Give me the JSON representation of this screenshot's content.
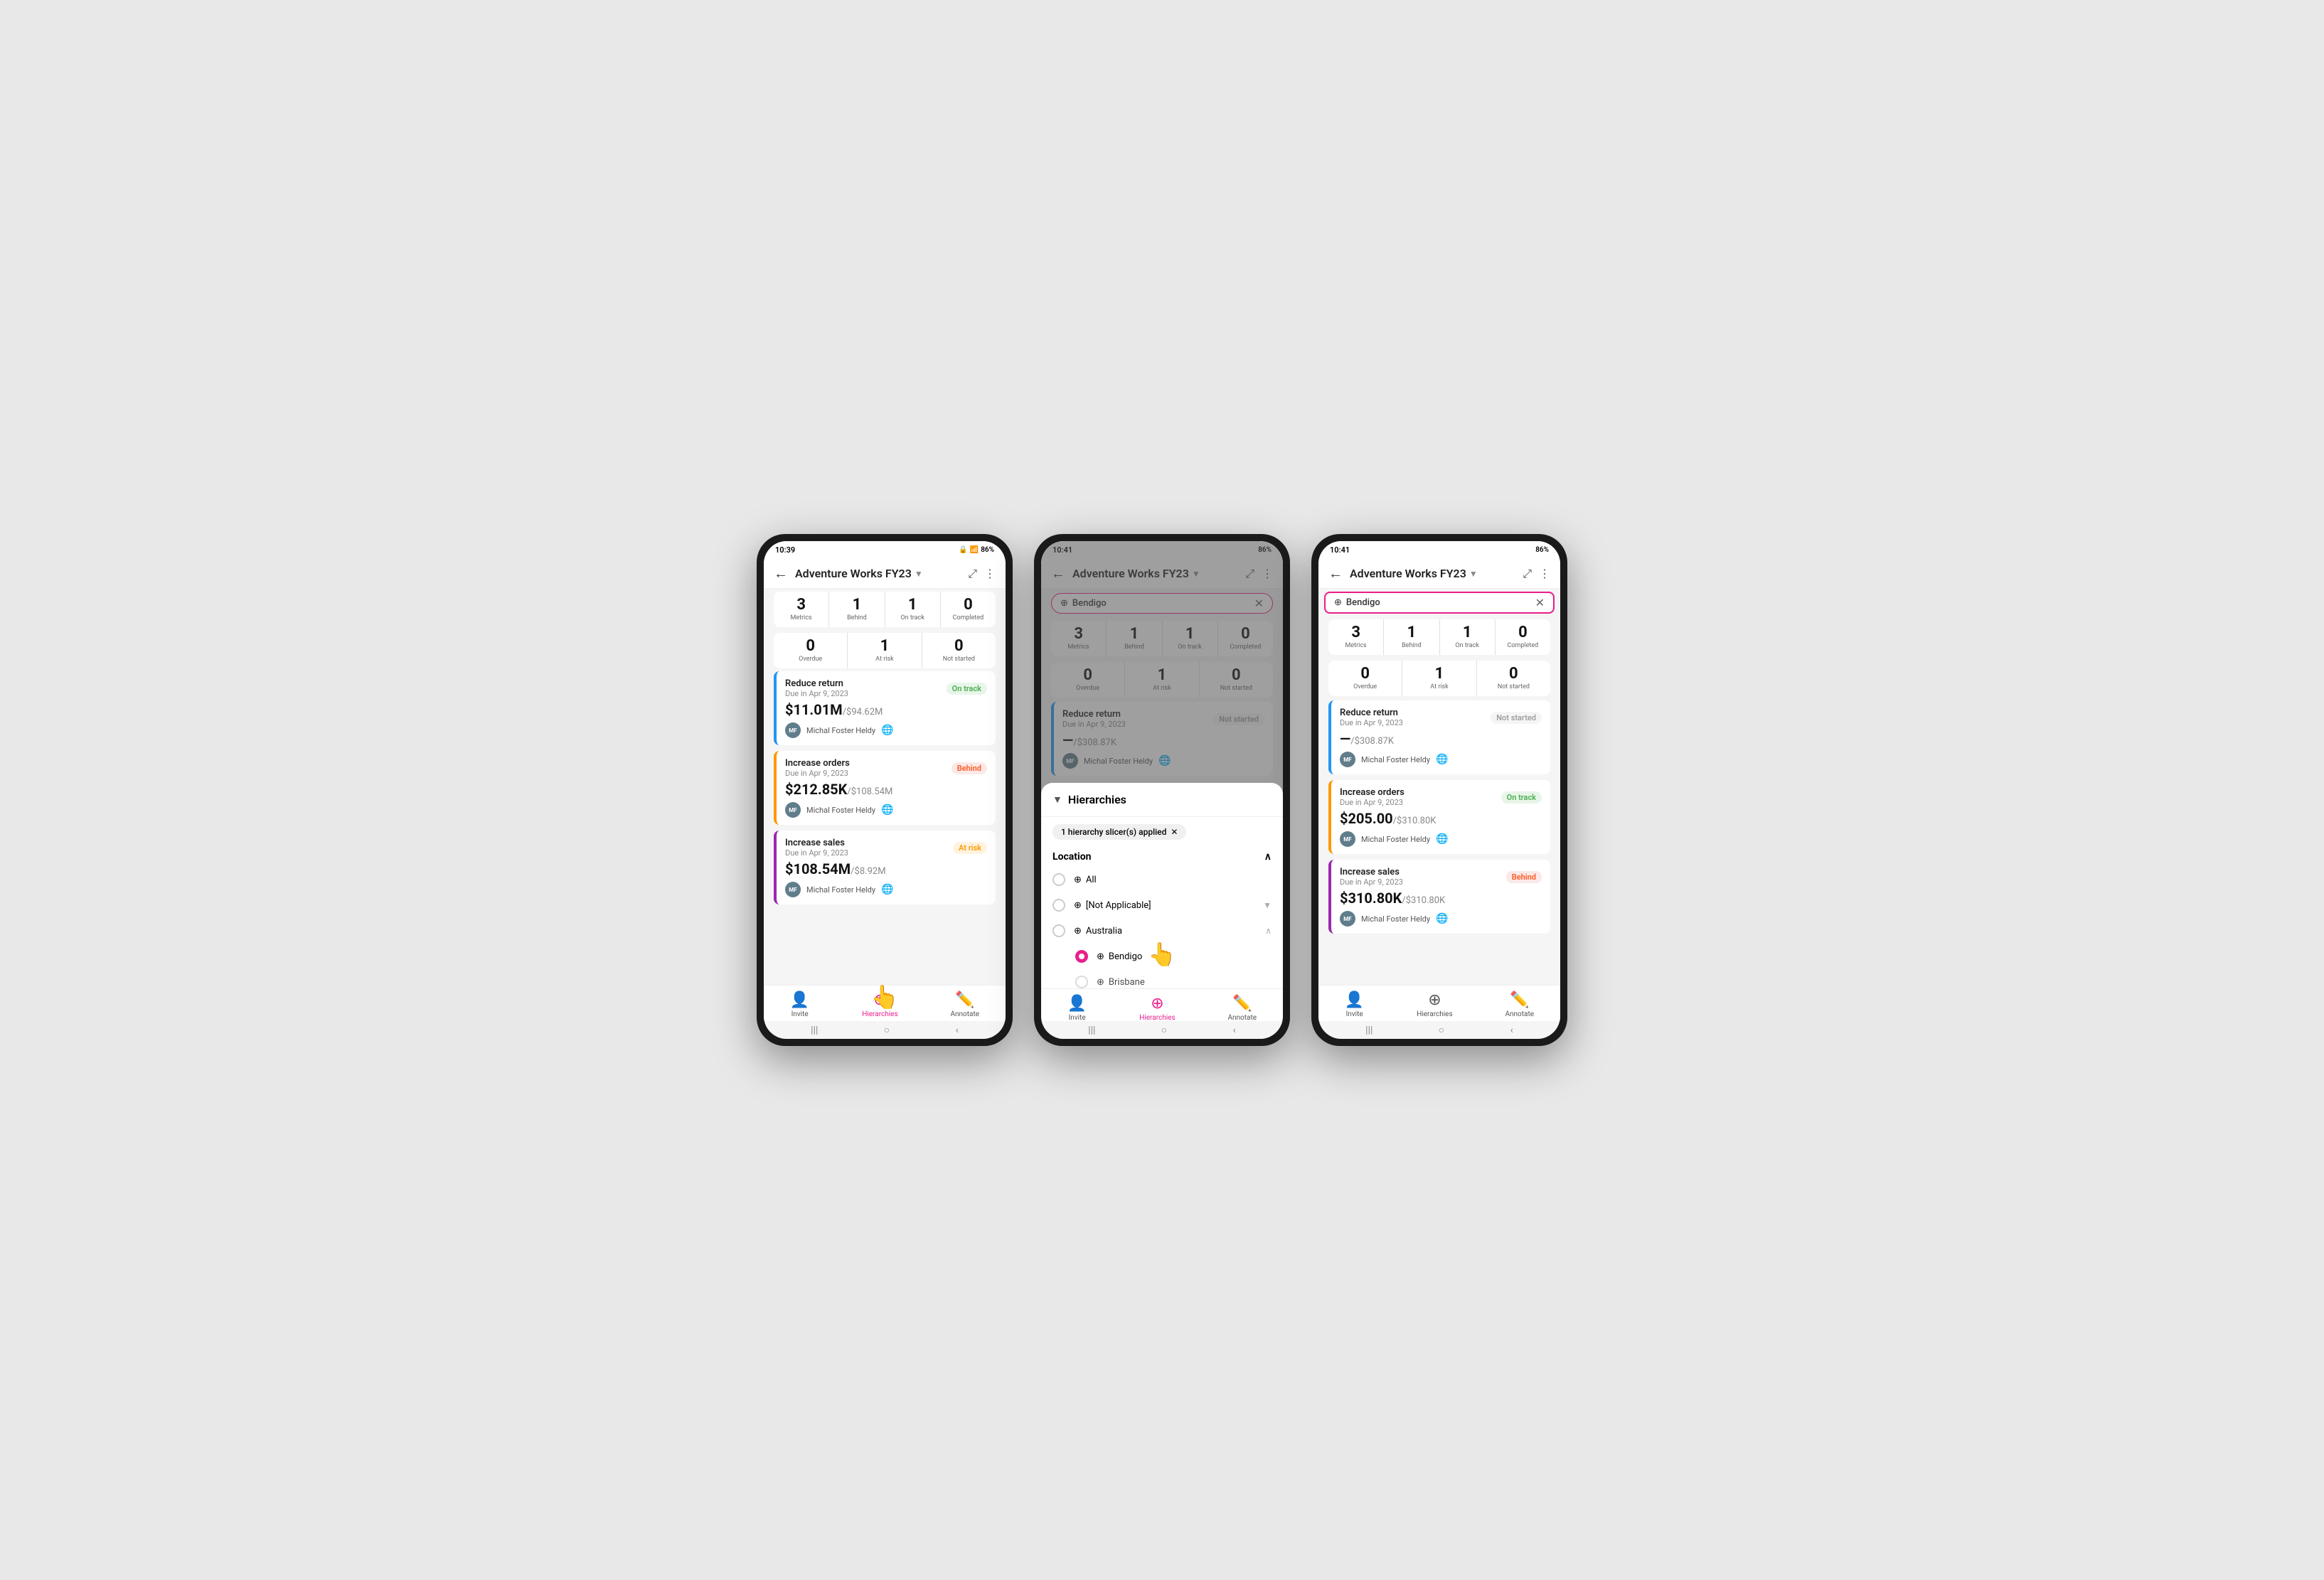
{
  "phone1": {
    "time": "10:39",
    "battery": "86%",
    "title": "Adventure Works FY23",
    "metrics_row1": [
      {
        "num": "3",
        "label": "Metrics"
      },
      {
        "num": "1",
        "label": "Behind"
      },
      {
        "num": "1",
        "label": "On track"
      },
      {
        "num": "0",
        "label": "Completed"
      }
    ],
    "metrics_row2": [
      {
        "num": "0",
        "label": "Overdue"
      },
      {
        "num": "1",
        "label": "At risk"
      },
      {
        "num": "0",
        "label": "Not started"
      }
    ],
    "kpis": [
      {
        "color": "blue",
        "title": "Reduce return",
        "due": "Due in Apr 9, 2023",
        "status": "On track",
        "status_class": "status-ontrack",
        "value": "$11.01M",
        "target": "/$94.62M",
        "owner": "Michal Foster Heldy",
        "initials": "MF"
      },
      {
        "color": "orange",
        "title": "Increase orders",
        "due": "Due in Apr 9, 2023",
        "status": "Behind",
        "status_class": "status-behind",
        "value": "$212.85K",
        "target": "/$108.54M",
        "owner": "Michal Foster Heldy",
        "initials": "MF"
      },
      {
        "color": "purple",
        "title": "Increase sales",
        "due": "Due in Apr 9, 2023",
        "status": "At risk",
        "status_class": "status-atrisk",
        "value": "$108.54M",
        "target": "/$8.92M",
        "owner": "Michal Foster Heldy",
        "initials": "MF"
      }
    ],
    "nav": [
      {
        "label": "Invite",
        "icon": "👤",
        "active": false
      },
      {
        "label": "Hierarchies",
        "icon": "🔀",
        "active": true
      },
      {
        "label": "Annotate",
        "icon": "✏️",
        "active": false
      }
    ]
  },
  "phone2": {
    "time": "10:41",
    "battery": "86%",
    "title": "Adventure Works FY23",
    "filter": "Bendigo",
    "metrics_row1": [
      {
        "num": "3",
        "label": "Metrics"
      },
      {
        "num": "1",
        "label": "Behind"
      },
      {
        "num": "1",
        "label": "On track"
      },
      {
        "num": "0",
        "label": "Completed"
      }
    ],
    "metrics_row2": [
      {
        "num": "0",
        "label": "Overdue"
      },
      {
        "num": "1",
        "label": "At risk"
      },
      {
        "num": "0",
        "label": "Not started"
      }
    ],
    "kpi": {
      "color": "blue",
      "title": "Reduce return",
      "due": "Due in Apr 9, 2023",
      "status": "Not started",
      "status_class": "status-notstarted",
      "value": "—",
      "target": "/$308.87K",
      "owner": "Michal Foster Heldy",
      "initials": "MF"
    },
    "hierarchy_panel": {
      "title": "Hierarchies",
      "applied_label": "1 hierarchy slicer(s) applied",
      "section": "Location",
      "options": [
        {
          "label": "All",
          "selected": false,
          "expandable": false
        },
        {
          "label": "[Not Applicable]",
          "selected": false,
          "expandable": true
        },
        {
          "label": "Australia",
          "selected": false,
          "expandable": true,
          "expanded": true
        },
        {
          "label": "Bendigo",
          "selected": true,
          "expandable": false,
          "indent": true
        },
        {
          "label": "Brisbane",
          "selected": false,
          "expandable": false,
          "indent": true
        }
      ]
    },
    "nav": [
      {
        "label": "Invite",
        "icon": "👤",
        "active": false
      },
      {
        "label": "Hierarchies",
        "icon": "🔀",
        "active": true
      },
      {
        "label": "Annotate",
        "icon": "✏️",
        "active": false
      }
    ]
  },
  "phone3": {
    "time": "10:41",
    "battery": "86%",
    "title": "Adventure Works FY23",
    "filter": "Bendigo",
    "metrics_row1": [
      {
        "num": "3",
        "label": "Metrics"
      },
      {
        "num": "1",
        "label": "Behind"
      },
      {
        "num": "1",
        "label": "On track"
      },
      {
        "num": "0",
        "label": "Completed"
      }
    ],
    "metrics_row2": [
      {
        "num": "0",
        "label": "Overdue"
      },
      {
        "num": "1",
        "label": "At risk"
      },
      {
        "num": "0",
        "label": "Not started"
      }
    ],
    "kpis": [
      {
        "color": "blue",
        "title": "Reduce return",
        "due": "Due in Apr 9, 2023",
        "status": "Not started",
        "status_class": "status-notstarted",
        "value": "—",
        "target": "/$308.87K",
        "owner": "Michal Foster Heldy",
        "initials": "MF"
      },
      {
        "color": "orange",
        "title": "Increase orders",
        "due": "Due in Apr 9, 2023",
        "status": "On track",
        "status_class": "status-ontrack",
        "value": "$205.00",
        "target": "/$310.80K",
        "owner": "Michal Foster Heldy",
        "initials": "MF"
      },
      {
        "color": "purple",
        "title": "Increase sales",
        "due": "Due in Apr 9, 2023",
        "status": "Behind",
        "status_class": "status-behind",
        "value": "$310.80K",
        "target": "/$310.80K",
        "owner": "Michal Foster Heldy",
        "initials": "MF"
      }
    ],
    "nav": [
      {
        "label": "Invite",
        "icon": "👤",
        "active": false
      },
      {
        "label": "Hierarchies",
        "icon": "🔀",
        "active": false
      },
      {
        "label": "Annotate",
        "icon": "✏️",
        "active": false
      }
    ]
  }
}
